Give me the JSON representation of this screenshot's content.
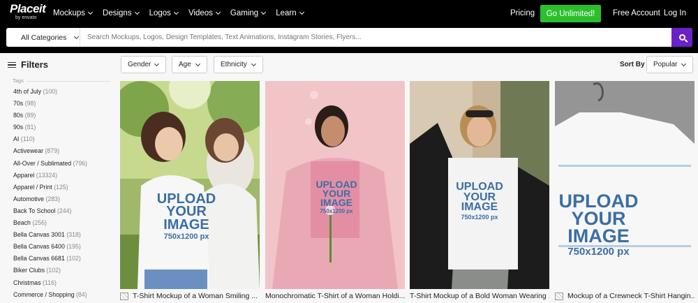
{
  "brand": {
    "logo_main": "Placeit",
    "logo_sub": "by envato"
  },
  "nav": {
    "items": [
      "Mockups",
      "Designs",
      "Logos",
      "Videos",
      "Gaming",
      "Learn"
    ],
    "pricing": "Pricing",
    "cta": "Go Unlimited!",
    "free_account": "Free Account",
    "login": "Log In"
  },
  "search": {
    "category": "All Categories",
    "placeholder": "Search Mockups, Logos, Design Templates, Text Animations, Instagram Stories, Flyers..."
  },
  "sidebar": {
    "title": "Filters",
    "section_label": "Tags",
    "tags": [
      {
        "name": "4th of July",
        "count": "(100)"
      },
      {
        "name": "70s",
        "count": "(98)"
      },
      {
        "name": "80s",
        "count": "(89)"
      },
      {
        "name": "90s",
        "count": "(81)"
      },
      {
        "name": "AI",
        "count": "(110)"
      },
      {
        "name": "Activewear",
        "count": "(879)"
      },
      {
        "name": "All-Over / Sublimated",
        "count": "(796)"
      },
      {
        "name": "Apparel",
        "count": "(13324)"
      },
      {
        "name": "Apparel / Print",
        "count": "(125)"
      },
      {
        "name": "Automotive",
        "count": "(283)"
      },
      {
        "name": "Back To School",
        "count": "(244)"
      },
      {
        "name": "Beach",
        "count": "(256)"
      },
      {
        "name": "Bella Canvas 3001",
        "count": "(318)"
      },
      {
        "name": "Bella Canvas 6400",
        "count": "(195)"
      },
      {
        "name": "Bella Canvas 6681",
        "count": "(102)"
      },
      {
        "name": "Biker Clubs",
        "count": "(102)"
      },
      {
        "name": "Christmas",
        "count": "(116)"
      },
      {
        "name": "Commerce / Shopping",
        "count": "(84)"
      }
    ]
  },
  "filters": {
    "gender": "Gender",
    "age": "Age",
    "ethnicity": "Ethnicity"
  },
  "sort": {
    "label": "Sort By",
    "value": "Popular"
  },
  "products": [
    {
      "title": "T-Shirt Mockup of a Woman Smiling ...",
      "print_line1": "UPLOAD",
      "print_line2": "YOUR",
      "print_line3": "IMAGE",
      "print_line4": "750x1200 px"
    },
    {
      "title": "Monochromatic T-Shirt of a Woman Holdi...",
      "print_line1": "UPLOAD",
      "print_line2": "YOUR",
      "print_line3": "IMAGE",
      "print_line4": "750x1200 px"
    },
    {
      "title": "T-Shirt Mockup of a Bold Woman Wearing ...",
      "print_line1": "UPLOAD",
      "print_line2": "YOUR",
      "print_line3": "IMAGE",
      "print_line4": "750x1200 px"
    },
    {
      "title": "Mockup of a Crewneck T-Shirt Hangin...",
      "print_line1": "UPLOAD",
      "print_line2": "YOUR",
      "print_line3": "IMAGE",
      "print_line4": "750x1200 px"
    }
  ],
  "colors": {
    "topbar": "#000000",
    "cta": "#2bbf2b",
    "search_button": "#6b21c9",
    "print_blue": "#3a6ea5"
  }
}
